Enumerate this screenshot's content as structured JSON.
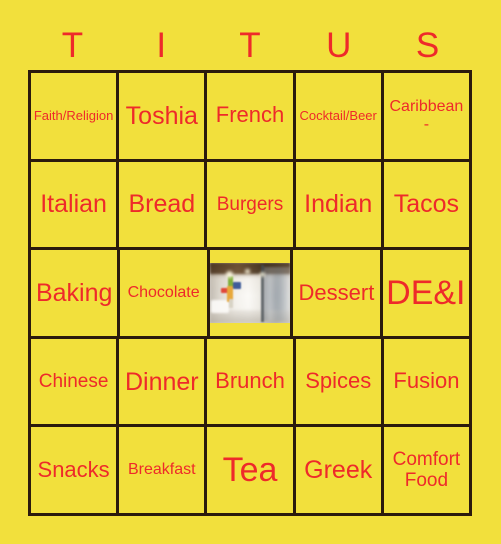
{
  "card": {
    "title_letters": [
      "T",
      "I",
      "T",
      "U",
      "S"
    ],
    "colors": {
      "background": "#f2e03c",
      "text": "#ee2a2a",
      "border": "#2b1a0d"
    },
    "grid": {
      "columns": 5,
      "rows": 5,
      "cells": [
        [
          {
            "label": "Faith/Religion",
            "size": "xs",
            "type": "text"
          },
          {
            "label": "Toshia",
            "size": "xl",
            "type": "text"
          },
          {
            "label": "French",
            "size": "lg",
            "type": "text"
          },
          {
            "label": "Cocktail/Beer",
            "size": "xs",
            "type": "text"
          },
          {
            "label": "Caribbean -",
            "size": "sm",
            "type": "text"
          }
        ],
        [
          {
            "label": "Italian",
            "size": "xl",
            "type": "text"
          },
          {
            "label": "Bread",
            "size": "xl",
            "type": "text"
          },
          {
            "label": "Burgers",
            "size": "md",
            "type": "text"
          },
          {
            "label": "Indian",
            "size": "xl",
            "type": "text"
          },
          {
            "label": "Tacos",
            "size": "xl",
            "type": "text"
          }
        ],
        [
          {
            "label": "Baking",
            "size": "xl",
            "type": "text"
          },
          {
            "label": "Chocolate",
            "size": "sm",
            "type": "text"
          },
          {
            "label": "",
            "size": "md",
            "type": "image",
            "image_name": "free-space-interior-photo"
          },
          {
            "label": "Dessert",
            "size": "lg",
            "type": "text"
          },
          {
            "label": "DE&I",
            "size": "xxl",
            "type": "text"
          }
        ],
        [
          {
            "label": "Chinese",
            "size": "md",
            "type": "text"
          },
          {
            "label": "Dinner",
            "size": "xl",
            "type": "text"
          },
          {
            "label": "Brunch",
            "size": "lg",
            "type": "text"
          },
          {
            "label": "Spices",
            "size": "lg",
            "type": "text"
          },
          {
            "label": "Fusion",
            "size": "lg",
            "type": "text"
          }
        ],
        [
          {
            "label": "Snacks",
            "size": "lg",
            "type": "text"
          },
          {
            "label": "Breakfast",
            "size": "sm",
            "type": "text"
          },
          {
            "label": "Tea",
            "size": "xxl",
            "type": "text"
          },
          {
            "label": "Greek",
            "size": "xl",
            "type": "text"
          },
          {
            "label": "Comfort Food",
            "size": "md",
            "type": "text"
          }
        ]
      ]
    }
  }
}
